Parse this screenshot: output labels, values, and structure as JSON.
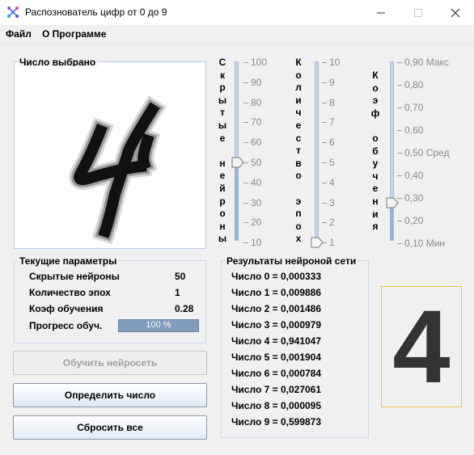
{
  "window": {
    "title": "Распознователь цифр от 0 до 9"
  },
  "menu": [
    {
      "label": "Файл"
    },
    {
      "label": "О Программе"
    }
  ],
  "canvas_panel": {
    "title": "Число выбрано"
  },
  "sliders": {
    "hidden_neurons": {
      "label": "Скрытые нейроны",
      "ticks": [
        "100",
        "90",
        "80",
        "70",
        "60",
        "50",
        "40",
        "30",
        "20",
        "10"
      ],
      "value": 50
    },
    "epochs": {
      "label": "Количество эпох",
      "ticks": [
        "10",
        "9",
        "8",
        "7",
        "6",
        "5",
        "4",
        "3",
        "2",
        "1"
      ],
      "value": 1
    },
    "learning_rate": {
      "label": "Коэф обучения",
      "ticks": [
        "0,90 Макс",
        "0,80",
        "0,70",
        "0,60",
        "0,50 Сред",
        "0,40",
        "0,30",
        "0,20",
        "0,10 Мин"
      ],
      "value": 0.28
    }
  },
  "params": {
    "title": "Текущие параметры",
    "rows": [
      {
        "label": "Скрытые нейроны",
        "value": "50"
      },
      {
        "label": "Количество эпох",
        "value": "1"
      },
      {
        "label": "Коэф обучения",
        "value": "0.28"
      }
    ],
    "progress_label": "Прогресс обуч.",
    "progress_text": "100 %",
    "progress_fraction": 1.0
  },
  "results": {
    "title": "Результаты нейроной сети",
    "lines": [
      "Число 0 = 0,000333",
      "Число 1 = 0,009886",
      "Число 2 = 0,001486",
      "Число 3 = 0,000979",
      "Число 4 = 0,941047",
      "Число 5 = 0,001904",
      "Число 6 = 0,000784",
      "Число 7 = 0,027061",
      "Число 8 = 0,000095",
      "Число 9 = 0,599873"
    ]
  },
  "buttons": {
    "train": "Обучить нейросеть",
    "recognize": "Определить число",
    "reset": "Сбросить все"
  },
  "prediction": {
    "digit": "4"
  },
  "colors": {
    "accent": "#8fb3dd",
    "prediction_border": "#f0c040"
  }
}
